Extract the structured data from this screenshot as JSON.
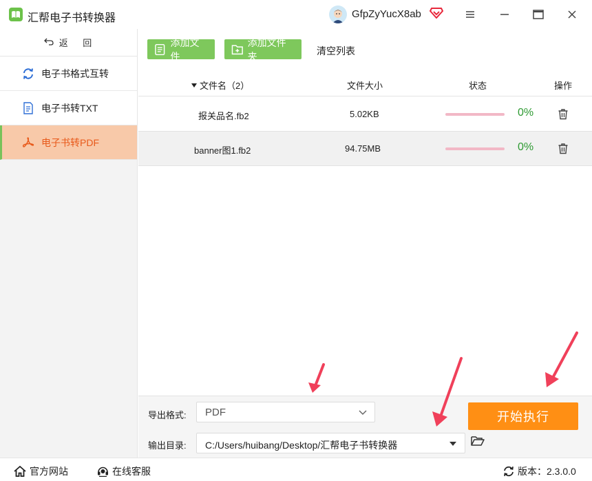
{
  "app": {
    "title": "汇帮电子书转换器"
  },
  "user": {
    "name": "GfpZyYucX8ab"
  },
  "sidebar": {
    "back_label": "返 回",
    "items": [
      {
        "label": "电子书格式互转",
        "icon": "refresh-icon"
      },
      {
        "label": "电子书转TXT",
        "icon": "document-icon"
      },
      {
        "label": "电子书转PDF",
        "icon": "pdf-icon",
        "active": true
      }
    ]
  },
  "toolbar": {
    "add_file": "添加文件",
    "add_folder": "添加文件夹",
    "clear_list": "清空列表"
  },
  "table": {
    "headers": {
      "name": "文件名（2）",
      "size": "文件大小",
      "status": "状态",
      "action": "操作"
    },
    "rows": [
      {
        "name": "报关品名.fb2",
        "size": "5.02KB",
        "progress": 0,
        "percent": "0%"
      },
      {
        "name": "banner图1.fb2",
        "size": "94.75MB",
        "progress": 0,
        "percent": "0%",
        "selected": true
      }
    ]
  },
  "settings": {
    "format_label": "导出格式:",
    "format_value": "PDF",
    "dir_label": "输出目录:",
    "dir_value": "C:/Users/huibang/Desktop/汇帮电子书转换器",
    "start_label": "开始执行"
  },
  "statusbar": {
    "website": "官方网站",
    "support": "在线客服",
    "version": "版本：2.3.0.0"
  },
  "colors": {
    "accent_green": "#7ec85c",
    "active_bg": "#f8c9a9",
    "active_text": "#e8591a",
    "start_orange": "#ff8f14",
    "percent_green": "#2e9a32",
    "arrow_red": "#f0405a"
  }
}
